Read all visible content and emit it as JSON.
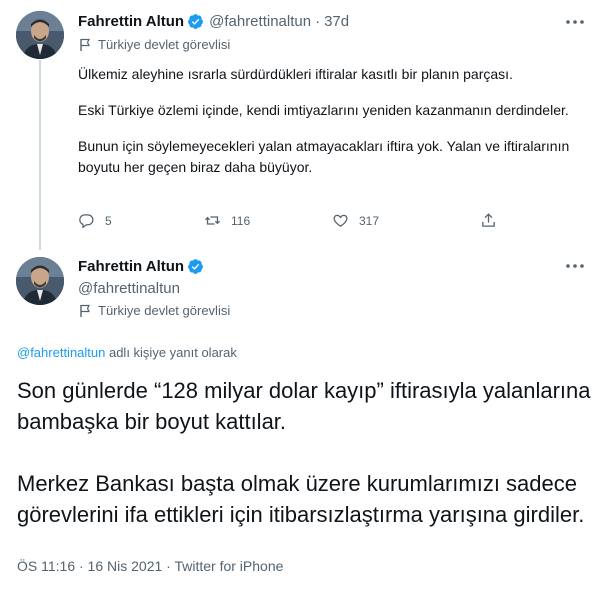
{
  "tweet1": {
    "author_name": "Fahrettin Altun",
    "handle": "@fahrettinaltun",
    "separator": "·",
    "timestamp": "37d",
    "label": "Türkiye devlet görevlisi",
    "paragraphs": [
      "Ülkemiz aleyhine ısrarla sürdürdükleri iftiralar kasıtlı bir planın parçası.",
      "Eski Türkiye özlemi içinde, kendi imtiyazlarını yeniden kazanmanın derdindeler.",
      "Bunun için söylemeyecekleri yalan atmayacakları iftira yok. Yalan ve iftiralarının boyutu her geçen biraz daha büyüyor."
    ],
    "actions": {
      "reply_count": "5",
      "retweet_count": "116",
      "like_count": "317"
    }
  },
  "tweet2": {
    "author_name": "Fahrettin Altun",
    "handle": "@fahrettinaltun",
    "label": "Türkiye devlet görevlisi",
    "reply_mention": "@fahrettinaltun",
    "reply_suffix": " adlı kişiye yanıt olarak",
    "paragraphs": [
      "Son günlerde “128 milyar dolar kayıp” iftirasıyla yalanlarına bambaşka bir boyut kattılar.",
      "Merkez Bankası başta olmak üzere kurumlarımızı sadece görevlerini ifa ettikleri için itibarsızlaştırma yarışına girdiler."
    ],
    "meta": "ÖS 11:16 · 16 Nis 2021 · Twitter for iPhone"
  },
  "icons": {
    "verified": "verified-badge-icon",
    "flag": "flag-icon",
    "more": "more-dots-icon",
    "reply": "reply-icon",
    "retweet": "retweet-icon",
    "like": "heart-icon",
    "share": "share-icon"
  },
  "colors": {
    "accent": "#1d9bf0",
    "text": "#0f1419",
    "secondary": "#536471",
    "divider": "#cfd9de"
  }
}
